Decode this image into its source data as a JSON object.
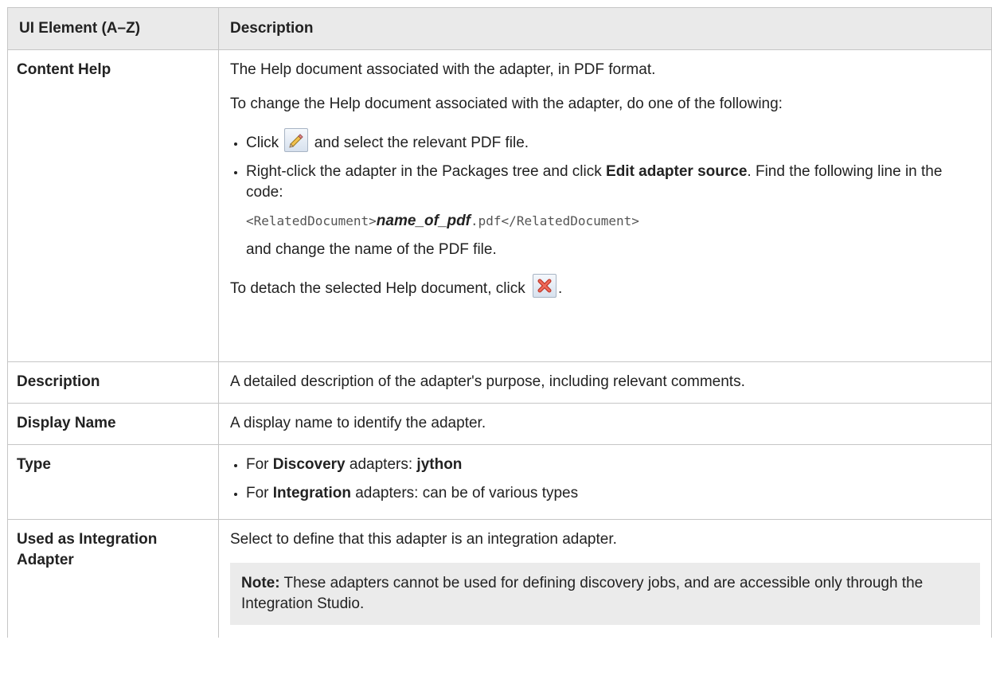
{
  "table": {
    "headers": [
      "UI Element (A–Z)",
      "Description"
    ],
    "rows": {
      "content_help": {
        "element": "Content Help",
        "desc1": "The Help document associated with the adapter, in PDF format.",
        "desc2": "To change the Help document associated with the adapter, do one of the following:",
        "bullet1_pre": "Click",
        "bullet1_post": "and select the relevant PDF file.",
        "bullet2_pre": "Right-click the adapter in the Packages tree and click",
        "bullet2_bold": "Edit adapter source",
        "bullet2_post": ". Find the following line in the code:",
        "code_open": "<RelatedDocument>",
        "code_var": "name_of_pdf",
        "code_close": ".pdf</RelatedDocument>",
        "after_code": "and change the name of the PDF file.",
        "detach_text": "To detach the selected Help document, click",
        "detach_end": ".",
        "edit_icon": "pencil-icon",
        "detach_icon": "red-x-icon"
      },
      "description": {
        "element": "Description",
        "text": "A detailed description of the adapter's purpose, including relevant comments."
      },
      "display_name": {
        "element": "Display Name",
        "text": "A display name to identify the adapter."
      },
      "type": {
        "element": "Type",
        "b1_pre": "For",
        "b1_bold": "Discovery",
        "b1_mid": "adapters:",
        "b1_value": "jython",
        "b2_pre": "For",
        "b2_bold": "Integration",
        "b2_post": "adapters: can be of various types"
      },
      "used_as_integration": {
        "element": "Used as Integration Adapter",
        "text": "Select to define that this adapter is an integration adapter.",
        "note_label": "Note:",
        "note_text": "These adapters cannot be used for defining discovery jobs, and are accessible only through the Integration Studio."
      }
    }
  },
  "colors": {
    "header_bg": "#eaeaea",
    "note_bg": "#ebebeb",
    "border": "#c6c6c6"
  }
}
